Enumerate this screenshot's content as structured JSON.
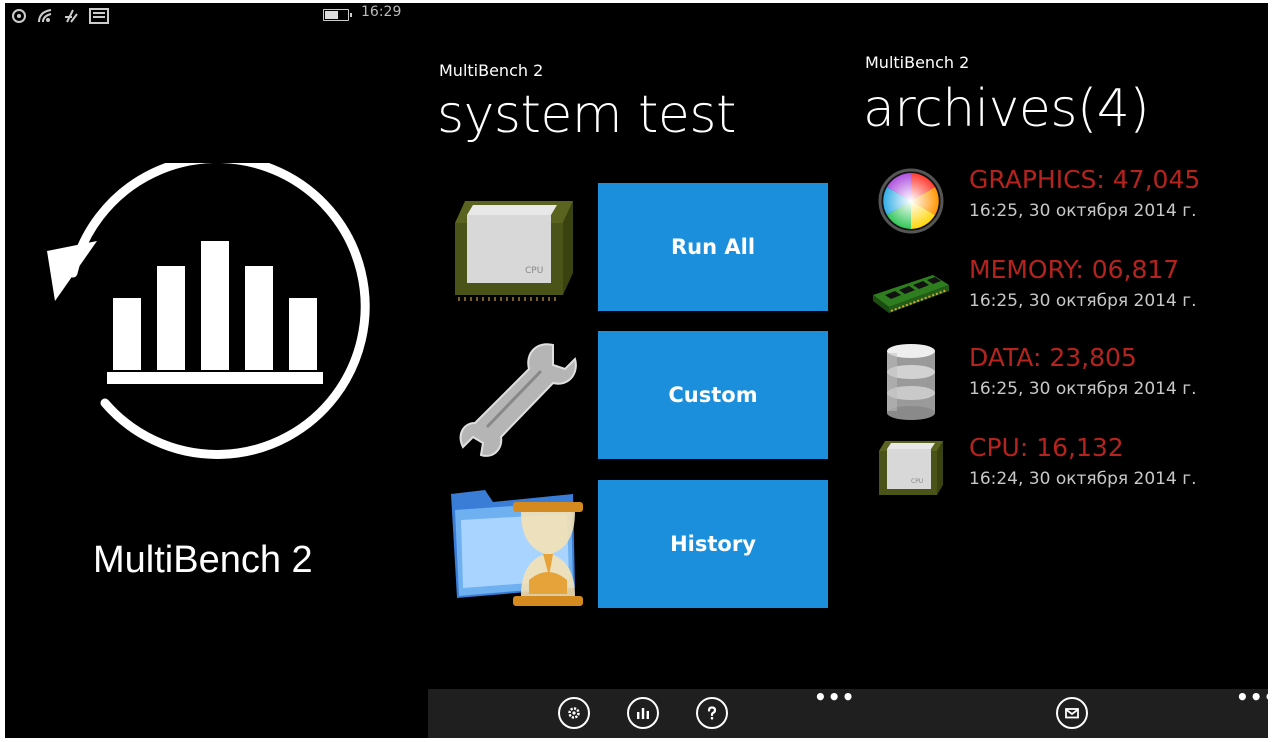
{
  "status_bar": {
    "time": "16:29"
  },
  "splash": {
    "app_name": "MultiBench 2"
  },
  "system_test": {
    "app_label": "MultiBench 2",
    "title": "system test",
    "tiles": [
      {
        "label": "Run All",
        "icon": "cpu-chip-icon"
      },
      {
        "label": "Custom",
        "icon": "wrench-icon"
      },
      {
        "label": "History",
        "icon": "folder-hourglass-icon"
      }
    ]
  },
  "archives": {
    "app_label": "MultiBench 2",
    "title": "archives(4)",
    "items": [
      {
        "title": "GRAPHICS: 47,045",
        "date": "16:25, 30 октября 2014 г.",
        "icon": "color-wheel-icon"
      },
      {
        "title": "MEMORY: 06,817",
        "date": "16:25, 30 октября 2014 г.",
        "icon": "ram-module-icon"
      },
      {
        "title": "DATA: 23,805",
        "date": "16:25, 30 октября 2014 г.",
        "icon": "database-icon"
      },
      {
        "title": "CPU: 16,132",
        "date": "16:24, 30 октября 2014 г.",
        "icon": "cpu-chip-icon"
      }
    ]
  },
  "app_bar": {
    "buttons": [
      "settings-icon",
      "chart-icon",
      "help-icon",
      "mail-icon"
    ],
    "more": "•••"
  },
  "colors": {
    "tile": "#1b8fdb",
    "archive_title": "#b5231f",
    "app_bar": "#1f1f1f"
  }
}
